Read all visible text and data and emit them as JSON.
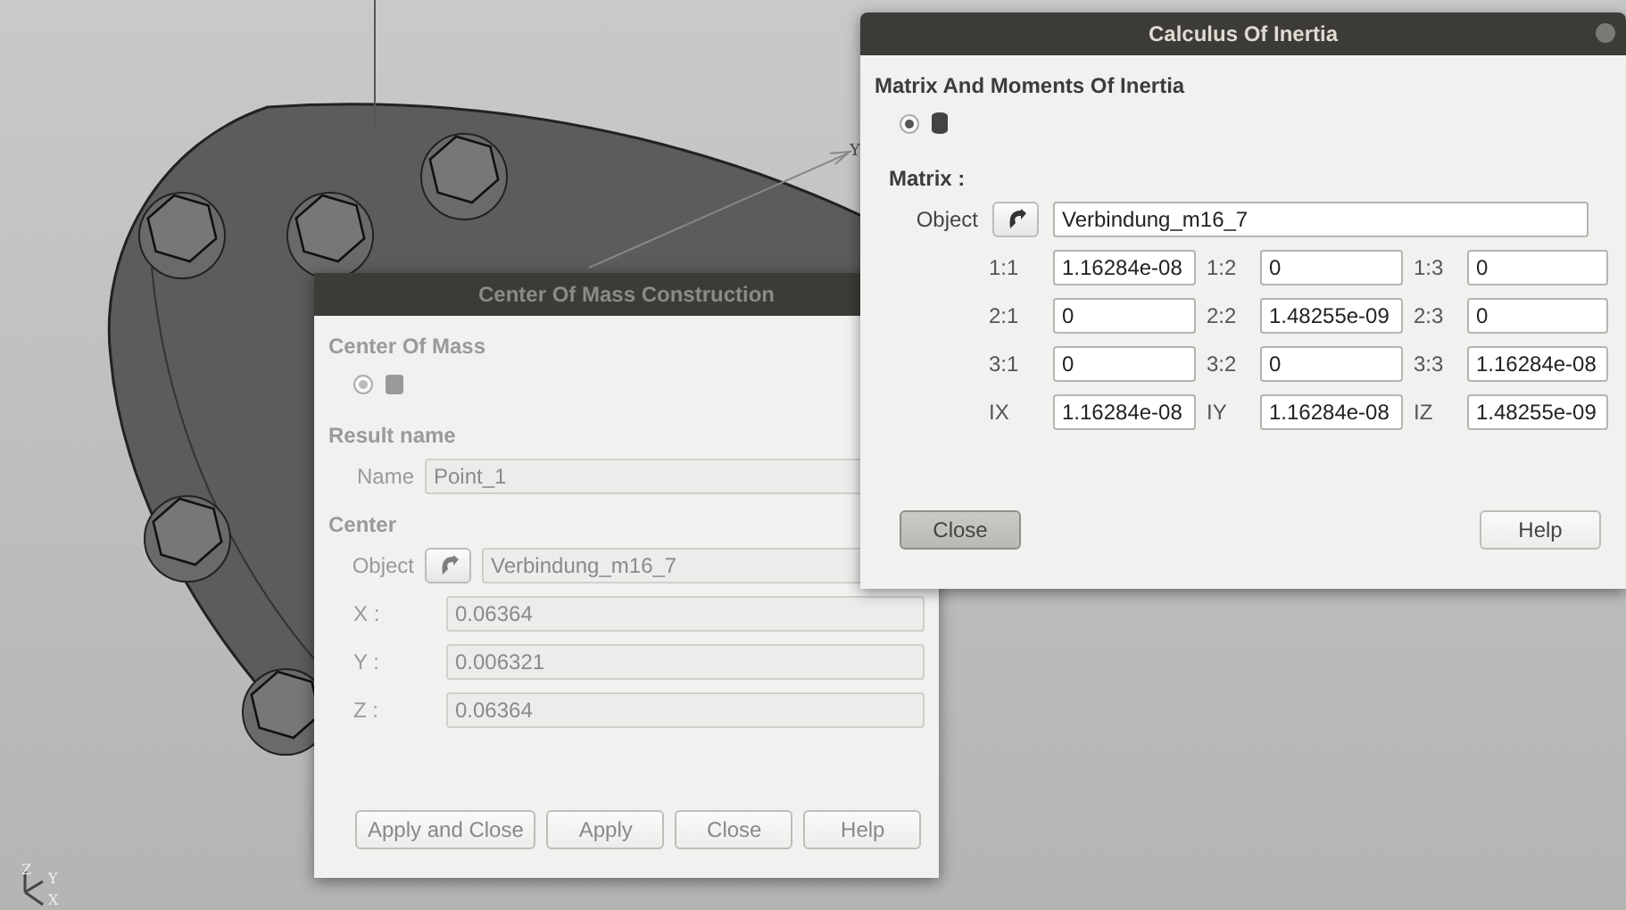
{
  "viewport": {
    "axis_label": "Y",
    "triad": [
      "Z",
      "Y",
      "X"
    ]
  },
  "center_of_mass_dialog": {
    "title": "Center Of Mass Construction",
    "active": false,
    "heading": "Center Of Mass",
    "mode_selected": true,
    "result_heading": "Result name",
    "name_label": "Name",
    "name_value": "Point_1",
    "center_heading": "Center",
    "object_label": "Object",
    "object_value": "Verbindung_m16_7",
    "coords": [
      {
        "label": "X :",
        "value": "0.06364"
      },
      {
        "label": "Y :",
        "value": "0.006321"
      },
      {
        "label": "Z :",
        "value": "0.06364"
      }
    ],
    "buttons": [
      {
        "label": "Apply and Close",
        "focused": false
      },
      {
        "label": "Apply",
        "focused": false
      },
      {
        "label": "Close",
        "focused": false
      },
      {
        "label": "Help",
        "focused": false
      }
    ]
  },
  "inertia_dialog": {
    "title": "Calculus Of Inertia",
    "active": true,
    "heading": "Matrix And Moments Of Inertia",
    "mode_selected": true,
    "matrix_label": "Matrix :",
    "object_label": "Object",
    "object_value": "Verbindung_m16_7",
    "rows": [
      [
        {
          "label": "1:1",
          "value": "1.16284e-08"
        },
        {
          "label": "1:2",
          "value": "0"
        },
        {
          "label": "1:3",
          "value": "0"
        }
      ],
      [
        {
          "label": "2:1",
          "value": "0"
        },
        {
          "label": "2:2",
          "value": "1.48255e-09"
        },
        {
          "label": "2:3",
          "value": "0"
        }
      ],
      [
        {
          "label": "3:1",
          "value": "0"
        },
        {
          "label": "3:2",
          "value": "0"
        },
        {
          "label": "3:3",
          "value": "1.16284e-08"
        }
      ],
      [
        {
          "label": "IX",
          "value": "1.16284e-08"
        },
        {
          "label": "IY",
          "value": "1.16284e-08"
        },
        {
          "label": "IZ",
          "value": "1.48255e-09"
        }
      ]
    ],
    "buttons": [
      {
        "label": "Close",
        "focused": true
      },
      {
        "label": "Help",
        "focused": false
      }
    ]
  }
}
